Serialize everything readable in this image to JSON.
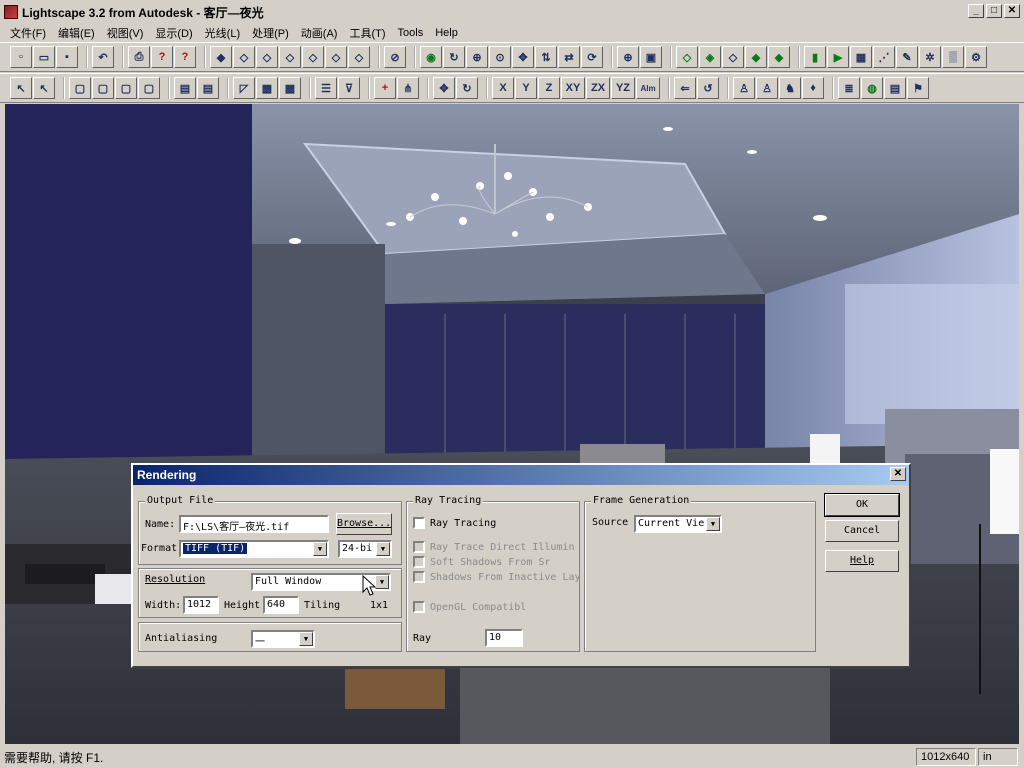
{
  "window": {
    "title": "Lightscape 3.2 from Autodesk - 客厅—夜光",
    "min_label": "_",
    "max_label": "□",
    "close_label": "✕"
  },
  "menu": {
    "items": [
      "文件(F)",
      "编辑(E)",
      "视图(V)",
      "显示(D)",
      "光线(L)",
      "处理(P)",
      "动画(A)",
      "工具(T)",
      "Tools",
      "Help"
    ]
  },
  "toolbar_row2": {
    "axis_buttons": [
      "X",
      "Y",
      "Z",
      "XY",
      "ZX",
      "YZ",
      "Alm"
    ]
  },
  "status": {
    "text": "需要帮助, 请按 F1.",
    "resolution": "1012x640",
    "units": "in"
  },
  "dialog": {
    "title": "Rendering",
    "close_label": "✕",
    "output_file": {
      "label": "Output File",
      "name_label": "Name:",
      "name_value": "F:\\LS\\客厅—夜光.tif",
      "browse_label": "Browse...",
      "format_label": "Format",
      "format_value": "TIFF (TIF)",
      "bits_value": "24-bi"
    },
    "resolution": {
      "label": "Resolution",
      "mode_value": "Full Window",
      "width_label": "Width:",
      "width_value": "1012",
      "height_label": "Height",
      "height_value": "640",
      "tiling_label": "Tiling",
      "tiling_value": "1x1"
    },
    "antialiasing": {
      "label": "Antialiasing",
      "value": "一"
    },
    "ray_tracing": {
      "label": "Ray Tracing",
      "enable_label": "Ray Tracing",
      "direct_label": "Ray Trace Direct Illumin",
      "soft_label": "Soft Shadows From Sr",
      "inactive_label": "Shadows From Inactive Lay",
      "opengl_label": "OpenGL Compatibl",
      "ray_label": "Ray",
      "ray_value": "10"
    },
    "frame": {
      "label": "Frame Generation",
      "source_label": "Source",
      "source_value": "Current Vie"
    },
    "buttons": {
      "ok": "OK",
      "cancel": "Cancel",
      "help": "Help"
    }
  }
}
